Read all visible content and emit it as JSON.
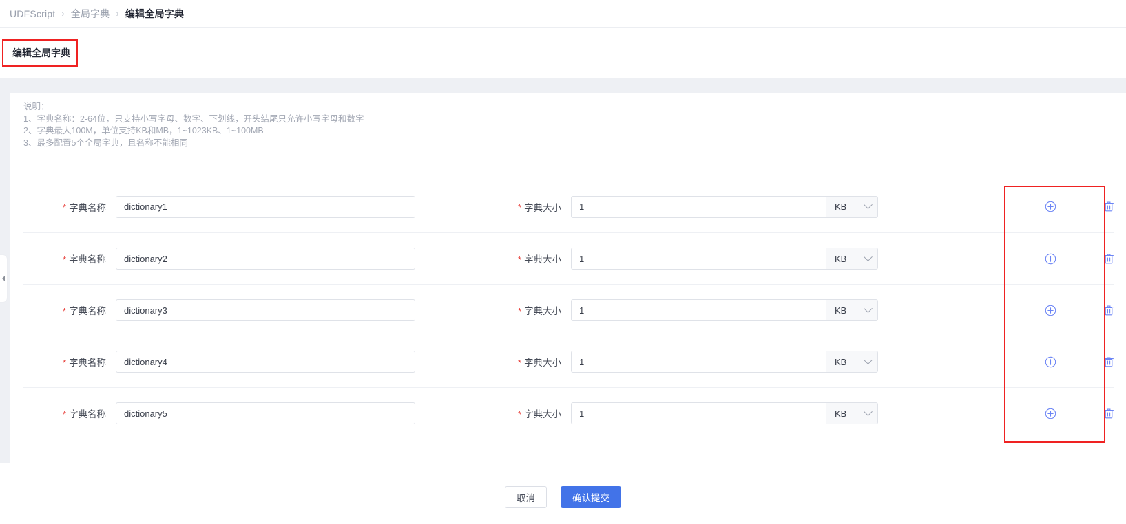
{
  "breadcrumb": {
    "items": [
      {
        "label": "UDFScript",
        "active": false
      },
      {
        "label": "全局字典",
        "active": false
      },
      {
        "label": "编辑全局字典",
        "active": true
      }
    ],
    "separator": "›"
  },
  "tab": {
    "label": "编辑全局字典"
  },
  "notes": {
    "heading": "说明：",
    "lines": [
      "1、字典名称：2-64位，只支持小写字母、数字、下划线，开头结尾只允许小写字母和数字",
      "2、字典最大100M，单位支持KB和MB，1~1023KB、1~100MB",
      "3、最多配置5个全局字典，且名称不能相同"
    ]
  },
  "form": {
    "name_label": "字典名称",
    "size_label": "字典大小",
    "required_marker": "*",
    "add_icon": "plus-circle-icon",
    "delete_icon": "trash-icon",
    "rows": [
      {
        "name": "dictionary1",
        "size": "1",
        "unit": "KB"
      },
      {
        "name": "dictionary2",
        "size": "1",
        "unit": "KB"
      },
      {
        "name": "dictionary3",
        "size": "1",
        "unit": "KB"
      },
      {
        "name": "dictionary4",
        "size": "1",
        "unit": "KB"
      },
      {
        "name": "dictionary5",
        "size": "1",
        "unit": "KB"
      }
    ]
  },
  "footer": {
    "cancel_label": "取消",
    "submit_label": "确认提交"
  },
  "colors": {
    "primary": "#4273e8",
    "icon_blue": "#6b84f5",
    "annotation_red": "#ef2222",
    "required_red": "#e8413c",
    "note_gray": "#a3a8b4"
  }
}
